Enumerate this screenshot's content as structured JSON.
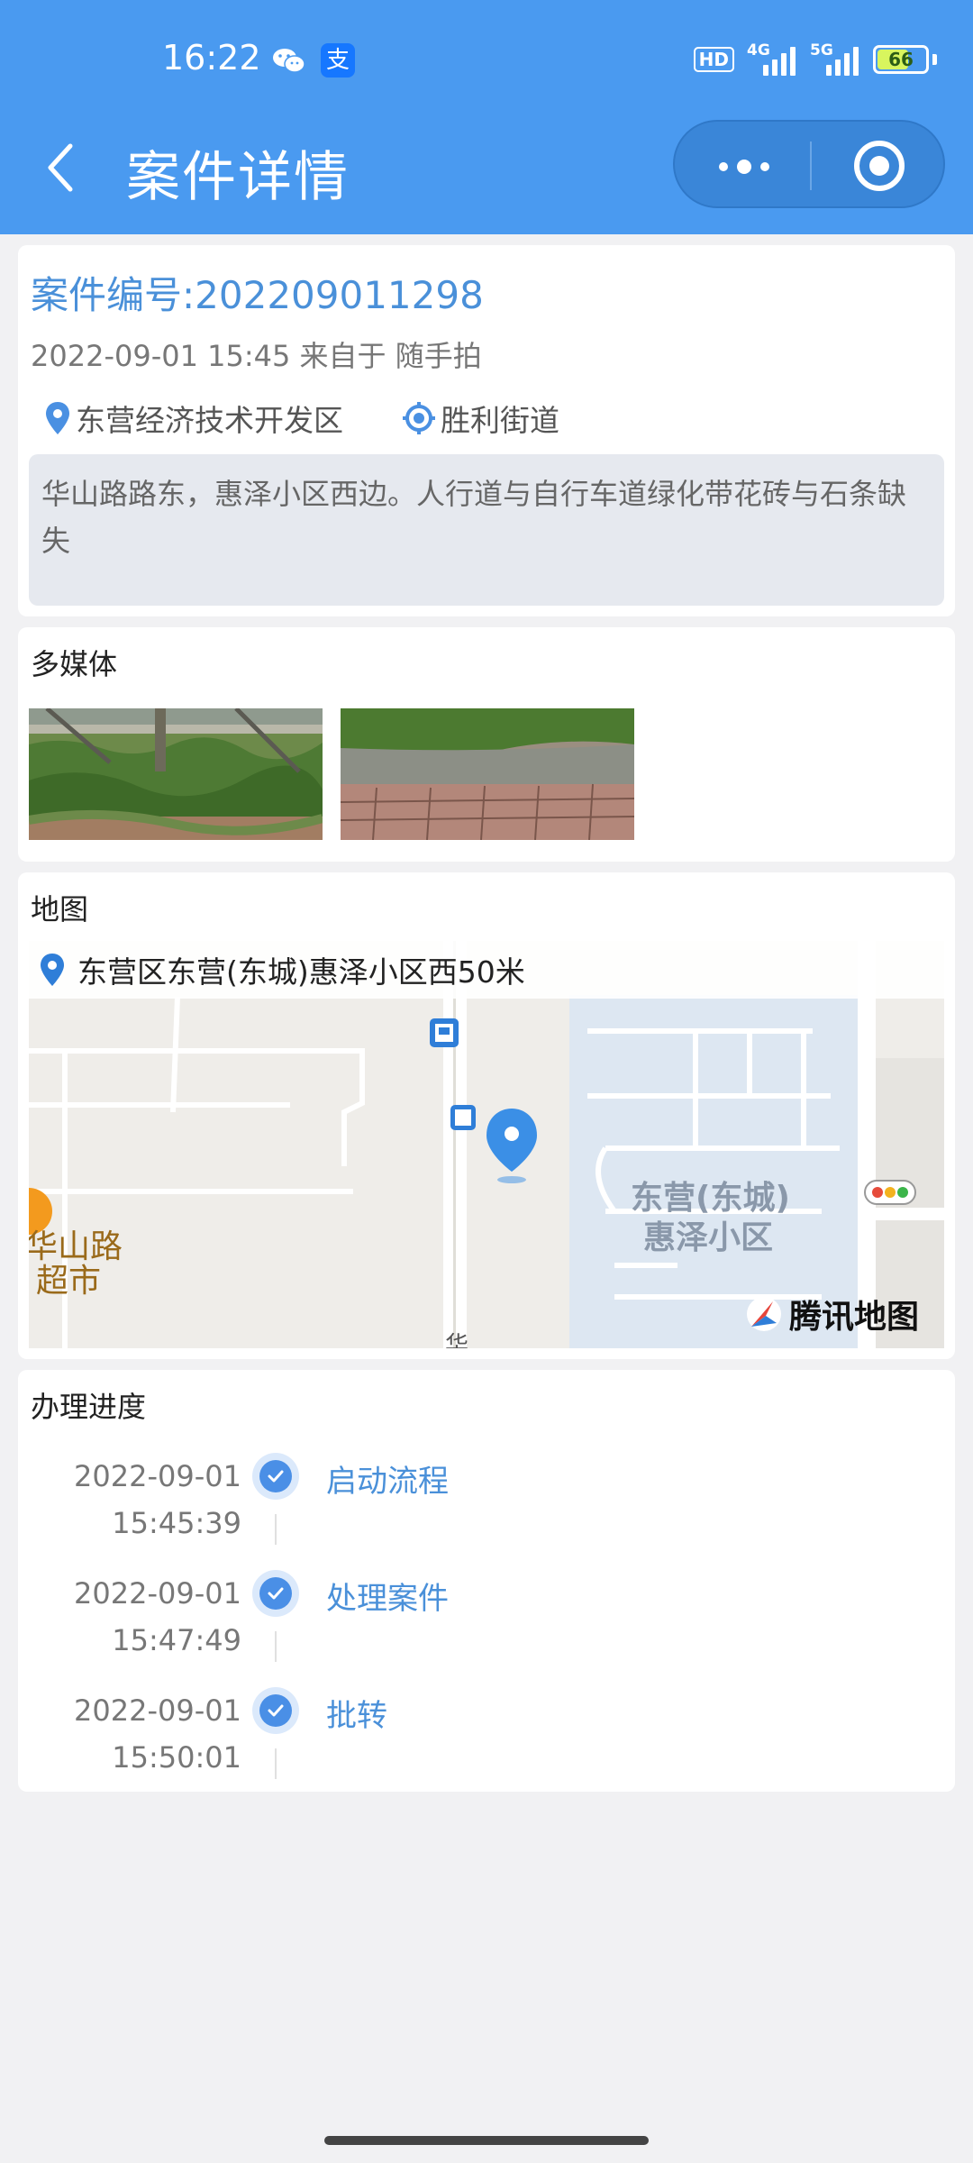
{
  "status_bar": {
    "time": "16:22",
    "hd_badge": "HD",
    "net1": "4G",
    "net2": "5G",
    "battery": "66"
  },
  "header": {
    "title": "案件详情"
  },
  "case": {
    "number_text": "案件编号:202209011298",
    "meta": "2022-09-01 15:45 来自于 随手拍",
    "district": "东营经济技术开发区",
    "street": "胜利街道",
    "description": "华山路路东，惠泽小区西边。人行道与自行车道绿化带花砖与石条缺失"
  },
  "media": {
    "title": "多媒体"
  },
  "map": {
    "title": "地图",
    "address": "东营区东营(东城)惠泽小区西50米",
    "labels": {
      "road": "华山路",
      "shop": "超市",
      "area_line1": "东营(东城)",
      "area_line2": "惠泽小区",
      "street_char": "华"
    },
    "brand": "腾讯地图"
  },
  "progress": {
    "title": "办理进度",
    "steps": [
      {
        "date": "2022-09-01",
        "time": "15:45:39",
        "label": "启动流程"
      },
      {
        "date": "2022-09-01",
        "time": "15:47:49",
        "label": "处理案件"
      },
      {
        "date": "2022-09-01",
        "time": "15:50:01",
        "label": "批转"
      }
    ]
  },
  "colors": {
    "header_bg": "#4a9af0",
    "accent": "#4a90d9",
    "page_bg": "#f1f1f3"
  }
}
